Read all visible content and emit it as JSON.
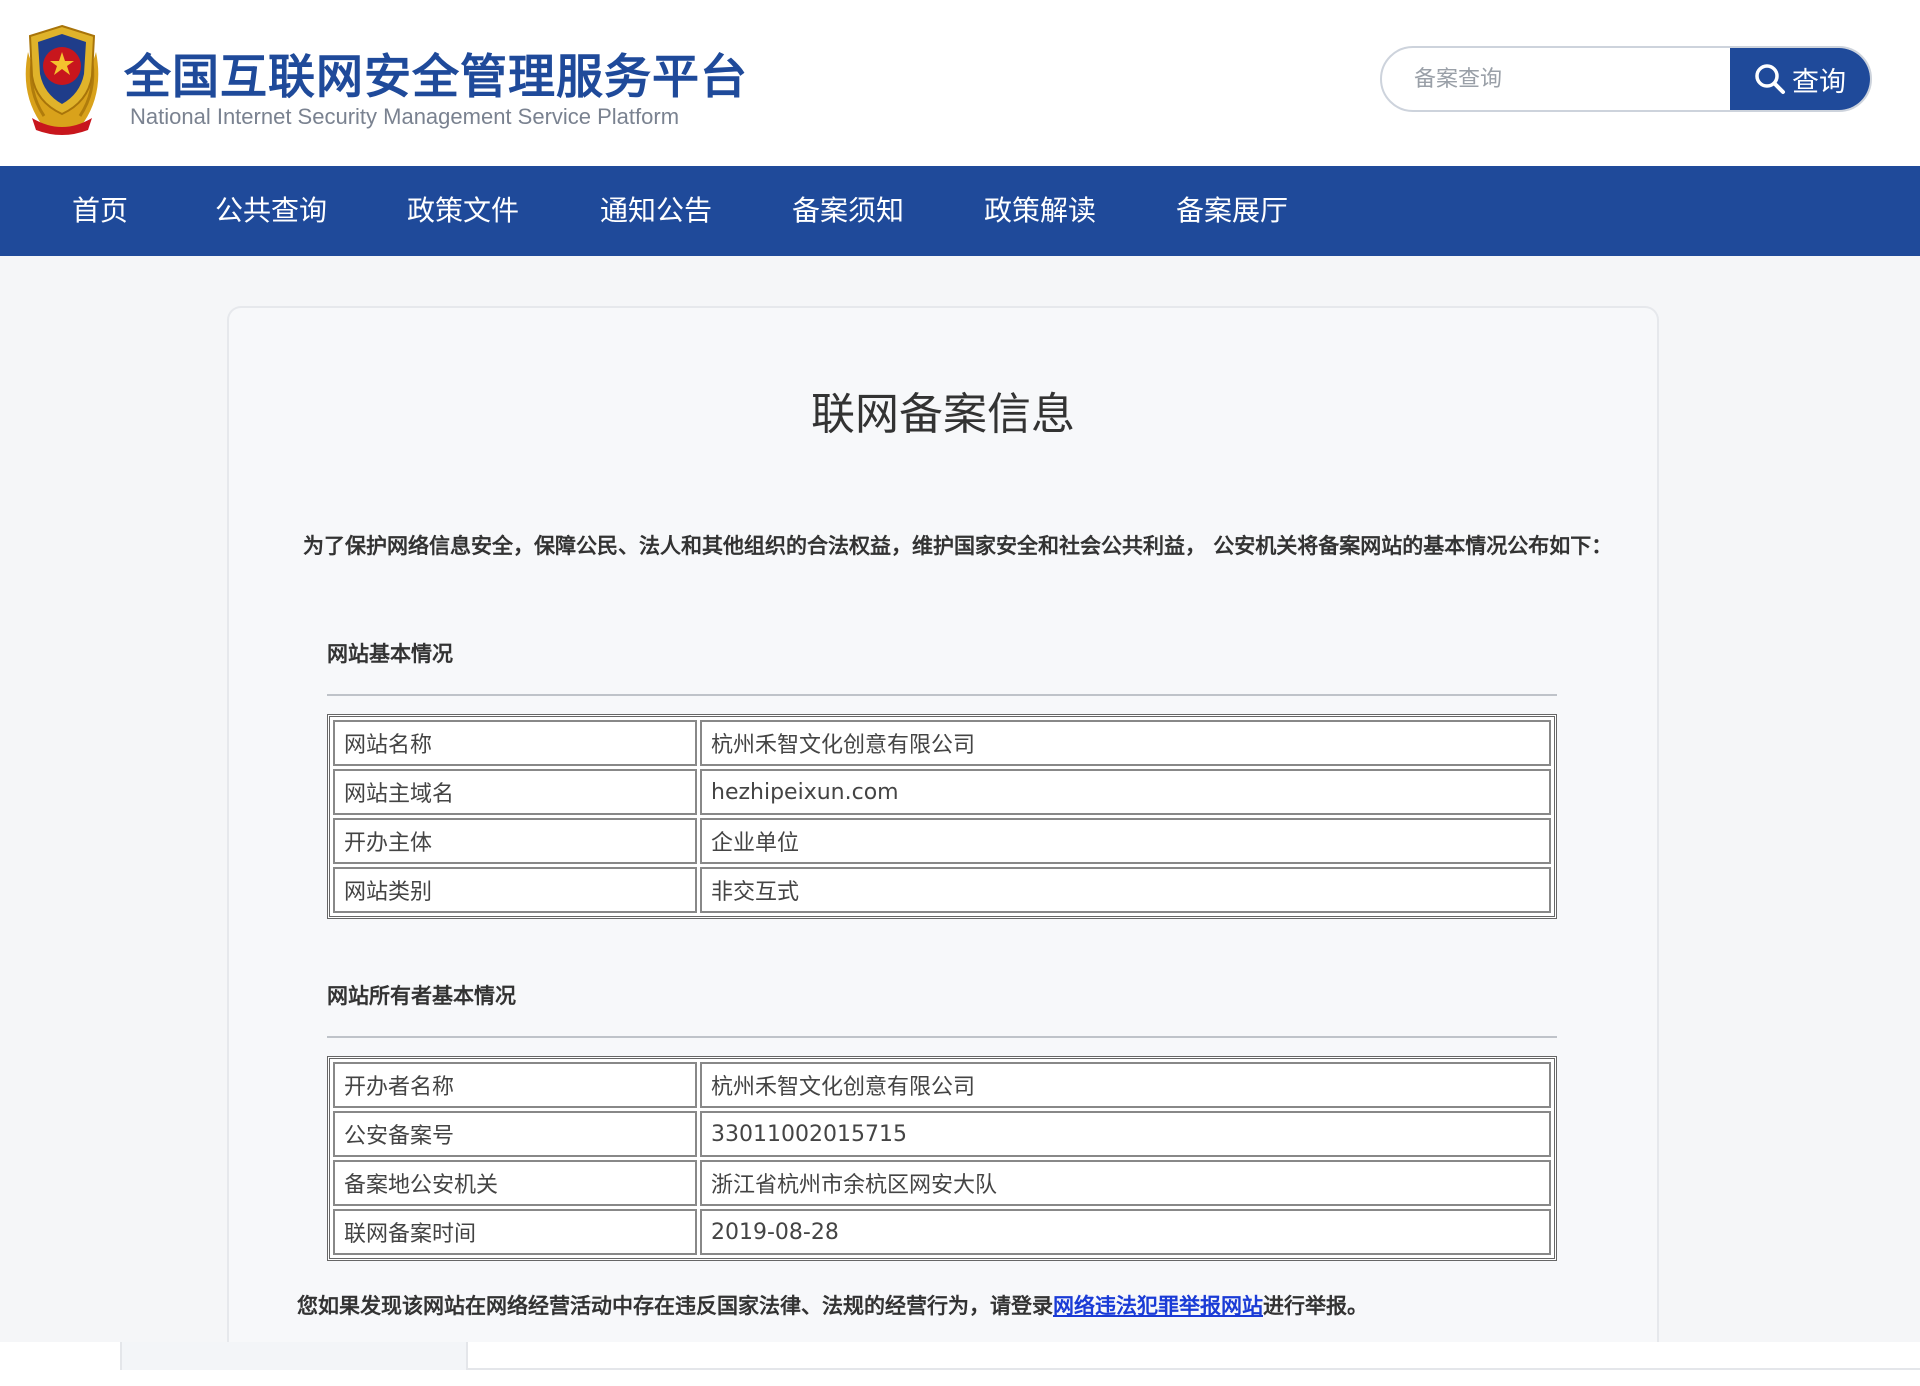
{
  "header": {
    "title": "全国互联网安全管理服务平台",
    "subtitle": "National Internet Security Management Service Platform",
    "emblem_icon": "national-police-emblem-icon"
  },
  "search": {
    "placeholder": "备案查询",
    "value": "",
    "button_label": "查询",
    "button_icon": "search-icon"
  },
  "nav": {
    "items": [
      {
        "label": "首页"
      },
      {
        "label": "公共查询"
      },
      {
        "label": "政策文件"
      },
      {
        "label": "通知公告"
      },
      {
        "label": "备案须知"
      },
      {
        "label": "政策解读"
      },
      {
        "label": "备案展厅"
      }
    ]
  },
  "main": {
    "title": "联网备案信息",
    "intro": "为了保护网络信息安全，保障公民、法人和其他组织的合法权益，维护国家安全和社会公共利益， 公安机关将备案网站的基本情况公布如下：",
    "site_section": {
      "heading": "网站基本情况",
      "rows": [
        {
          "label": "网站名称",
          "value": "杭州禾智文化创意有限公司"
        },
        {
          "label": "网站主域名",
          "value": "hezhipeixun.com"
        },
        {
          "label": "开办主体",
          "value": "企业单位"
        },
        {
          "label": "网站类别",
          "value": "非交互式"
        }
      ]
    },
    "owner_section": {
      "heading": "网站所有者基本情况",
      "rows": [
        {
          "label": "开办者名称",
          "value": "杭州禾智文化创意有限公司"
        },
        {
          "label": "公安备案号",
          "value": "33011002015715"
        },
        {
          "label": "备案地公安机关",
          "value": "浙江省杭州市余杭区网安大队"
        },
        {
          "label": "联网备案时间",
          "value": "2019-08-28"
        }
      ]
    },
    "footer": {
      "before": "您如果发现该网站在网络经营活动中存在违反国家法律、法规的经营行为，请登录",
      "link": "网络违法犯罪举报网站",
      "after": "进行举报。"
    }
  },
  "colors": {
    "brand_blue": "#1f4a9a",
    "link_blue": "#1a3bd6",
    "emblem_red": "#c8161d",
    "emblem_gold": "#d9a21b"
  }
}
